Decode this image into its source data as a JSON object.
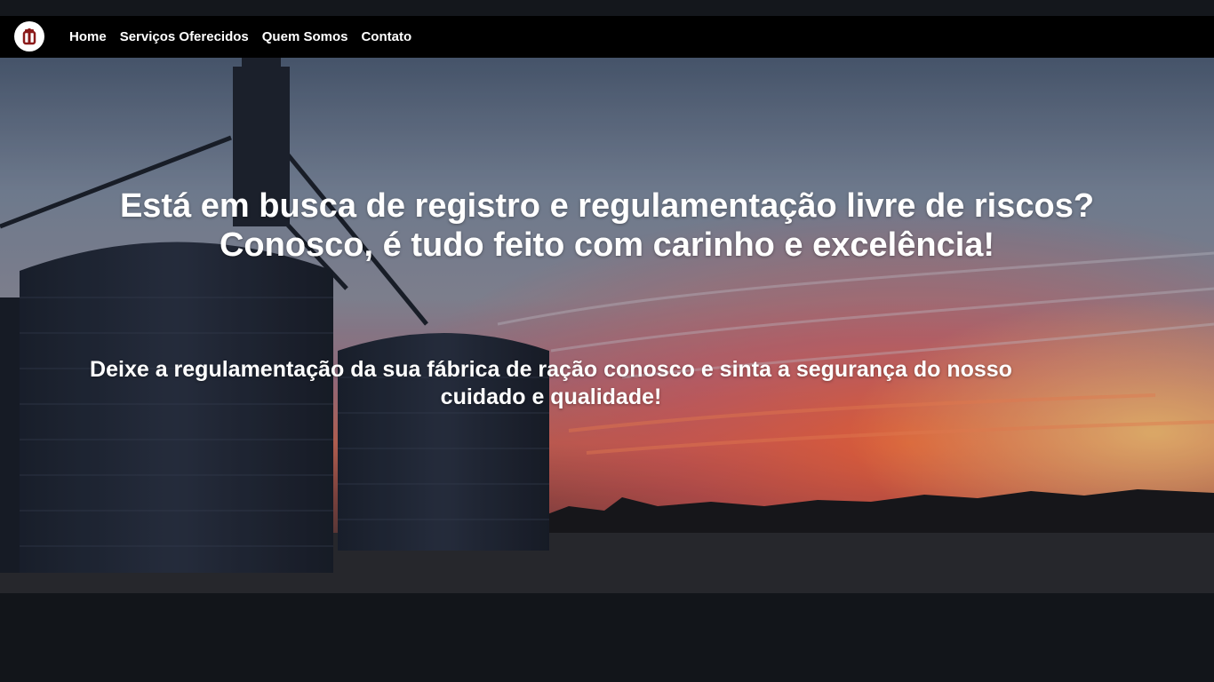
{
  "nav": {
    "logo_icon": "silo-logo-icon",
    "items": [
      {
        "label": "Home"
      },
      {
        "label": "Serviços Oferecidos"
      },
      {
        "label": "Quem Somos"
      },
      {
        "label": "Contato"
      }
    ]
  },
  "hero": {
    "title_line1": "Está em busca de registro e regulamentação livre de riscos?",
    "title_line2": "Conosco, é tudo feito com carinho e excelência!",
    "subtitle": "Deixe a regulamentação da sua fábrica de ração conosco e sinta a segurança do nosso cuidado e qualidade!",
    "background_image": "grain-silos-at-sunset"
  },
  "colors": {
    "navbar": "#000000",
    "page_background": "#12151a",
    "logo_accent": "#8b1a1a",
    "text": "#ffffff"
  }
}
